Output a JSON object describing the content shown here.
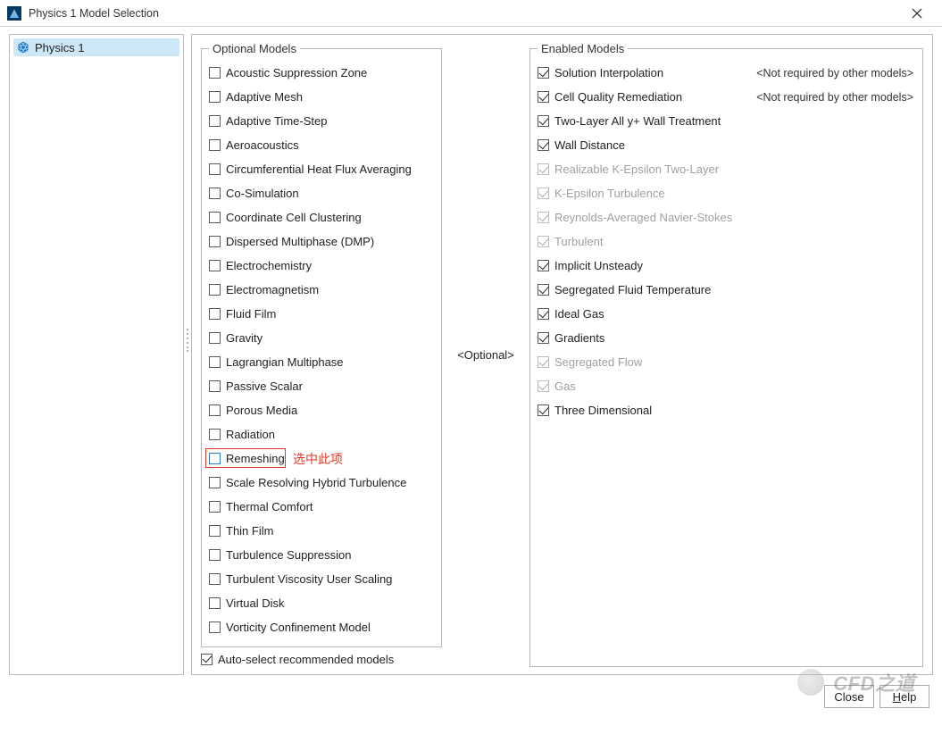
{
  "window": {
    "title": "Physics 1 Model Selection"
  },
  "tree": {
    "selected": "Physics 1"
  },
  "center_label": "<Optional>",
  "optional": {
    "title": "Optional Models",
    "items": [
      {
        "label": "Acoustic Suppression Zone"
      },
      {
        "label": "Adaptive Mesh"
      },
      {
        "label": "Adaptive Time-Step"
      },
      {
        "label": "Aeroacoustics"
      },
      {
        "label": "Circumferential Heat Flux Averaging"
      },
      {
        "label": "Co-Simulation"
      },
      {
        "label": "Coordinate Cell Clustering"
      },
      {
        "label": "Dispersed Multiphase (DMP)"
      },
      {
        "label": "Electrochemistry"
      },
      {
        "label": "Electromagnetism"
      },
      {
        "label": "Fluid Film"
      },
      {
        "label": "Gravity"
      },
      {
        "label": "Lagrangian Multiphase"
      },
      {
        "label": "Passive Scalar"
      },
      {
        "label": "Porous Media"
      },
      {
        "label": "Radiation"
      },
      {
        "label": "Remeshing",
        "highlighted": true
      },
      {
        "label": "Scale Resolving Hybrid Turbulence"
      },
      {
        "label": "Thermal Comfort"
      },
      {
        "label": "Thin Film"
      },
      {
        "label": "Turbulence Suppression"
      },
      {
        "label": "Turbulent Viscosity User Scaling"
      },
      {
        "label": "Virtual Disk"
      },
      {
        "label": "Vorticity Confinement Model"
      }
    ],
    "autoselect": "Auto-select recommended models"
  },
  "annotation": {
    "text": "选中此项"
  },
  "enabled": {
    "title": "Enabled Models",
    "items": [
      {
        "label": "Solution Interpolation",
        "checked": true,
        "disabled": false,
        "note": "<Not required by other models>"
      },
      {
        "label": "Cell Quality Remediation",
        "checked": true,
        "disabled": false,
        "note": "<Not required by other models>"
      },
      {
        "label": "Two-Layer All y+ Wall Treatment",
        "checked": true,
        "disabled": false
      },
      {
        "label": "Wall Distance",
        "checked": true,
        "disabled": false
      },
      {
        "label": "Realizable K-Epsilon Two-Layer",
        "checked": true,
        "disabled": true
      },
      {
        "label": "K-Epsilon Turbulence",
        "checked": true,
        "disabled": true
      },
      {
        "label": "Reynolds-Averaged Navier-Stokes",
        "checked": true,
        "disabled": true
      },
      {
        "label": "Turbulent",
        "checked": true,
        "disabled": true
      },
      {
        "label": "Implicit Unsteady",
        "checked": true,
        "disabled": false
      },
      {
        "label": "Segregated Fluid Temperature",
        "checked": true,
        "disabled": false
      },
      {
        "label": "Ideal Gas",
        "checked": true,
        "disabled": false
      },
      {
        "label": "Gradients",
        "checked": true,
        "disabled": false
      },
      {
        "label": "Segregated Flow",
        "checked": true,
        "disabled": true
      },
      {
        "label": "Gas",
        "checked": true,
        "disabled": true
      },
      {
        "label": "Three Dimensional",
        "checked": true,
        "disabled": false
      }
    ]
  },
  "buttons": {
    "close": "Close",
    "help": "Help"
  },
  "watermark": "CFD之道"
}
